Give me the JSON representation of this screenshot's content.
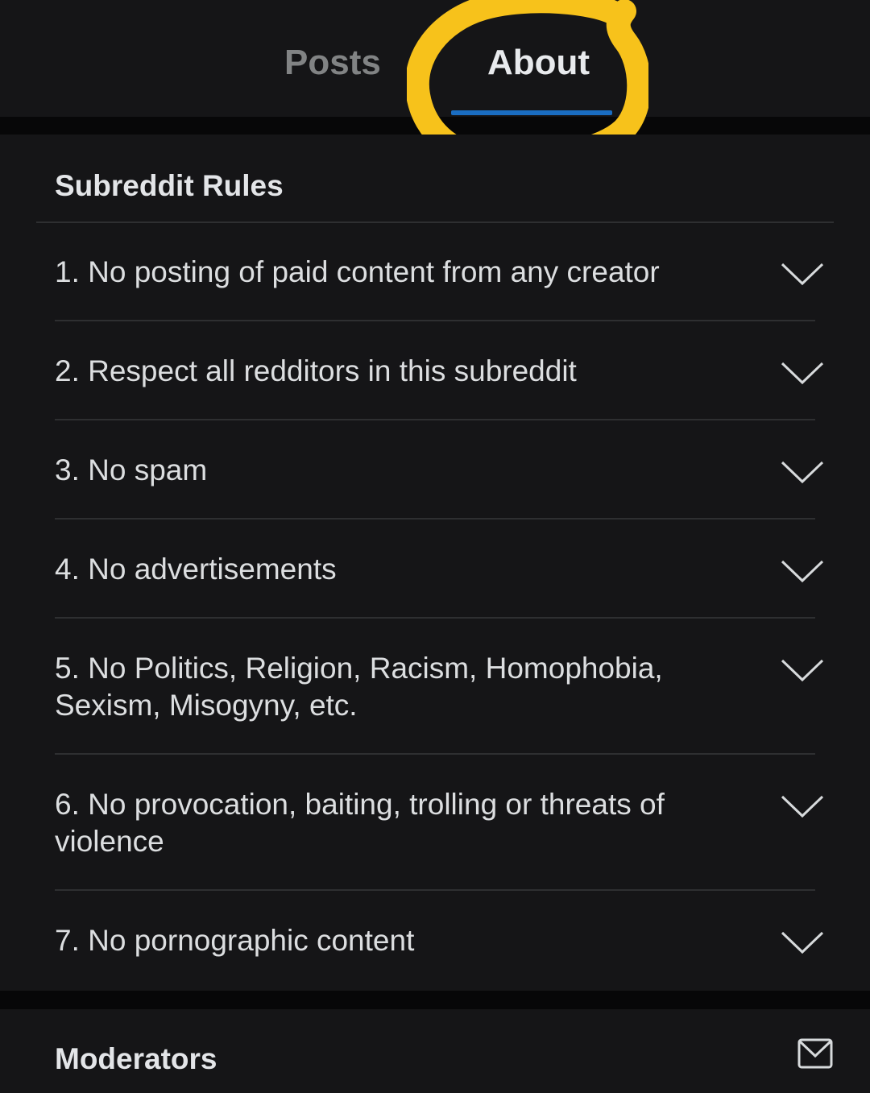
{
  "tabs": {
    "posts_label": "Posts",
    "about_label": "About",
    "active": "About",
    "accent_color": "#1a6dc2",
    "annotation_color": "#f7c21b"
  },
  "rules": {
    "title": "Subreddit Rules",
    "items": [
      {
        "text": "1. No posting of paid content from any creator",
        "icon": "chevron-down-icon"
      },
      {
        "text": "2. Respect all redditors in this subreddit",
        "icon": "chevron-down-icon"
      },
      {
        "text": "3. No spam",
        "icon": "chevron-down-icon"
      },
      {
        "text": "4. No advertisements",
        "icon": "chevron-down-icon"
      },
      {
        "text": "5. No Politics, Religion, Racism, Homophobia, Sexism, Misogyny, etc.",
        "icon": "chevron-down-icon"
      },
      {
        "text": "6. No provocation, baiting, trolling or threats of violence",
        "icon": "chevron-down-icon"
      },
      {
        "text": "7. No pornographic content",
        "icon": "chevron-down-icon"
      }
    ]
  },
  "moderators": {
    "title": "Moderators",
    "icon": "mail-icon"
  }
}
